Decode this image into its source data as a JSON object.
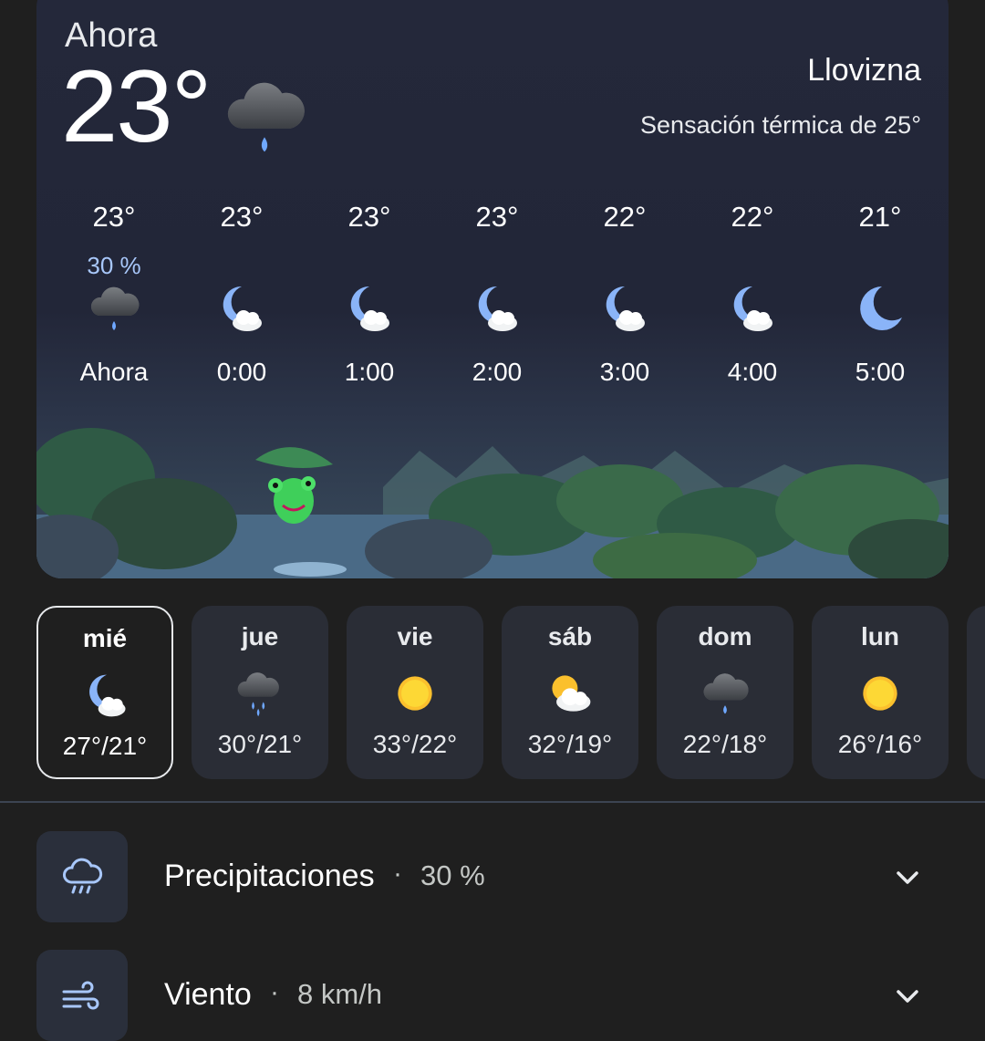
{
  "current": {
    "label": "Ahora",
    "temp": "23°",
    "icon": "drizzle-cloud-icon",
    "condition": "Llovizna",
    "feels_like": "Sensación térmica de 25°"
  },
  "hourly": [
    {
      "temp": "23°",
      "precip": "30 %",
      "icon": "drizzle-cloud-icon",
      "time": "Ahora"
    },
    {
      "temp": "23°",
      "precip": "",
      "icon": "moon-cloud-icon",
      "time": "0:00"
    },
    {
      "temp": "23°",
      "precip": "",
      "icon": "moon-cloud-icon",
      "time": "1:00"
    },
    {
      "temp": "23°",
      "precip": "",
      "icon": "moon-cloud-icon",
      "time": "2:00"
    },
    {
      "temp": "22°",
      "precip": "",
      "icon": "moon-cloud-icon",
      "time": "3:00"
    },
    {
      "temp": "22°",
      "precip": "",
      "icon": "moon-cloud-icon",
      "time": "4:00"
    },
    {
      "temp": "21°",
      "precip": "",
      "icon": "moon-icon",
      "time": "5:00"
    }
  ],
  "daily": [
    {
      "day": "mié",
      "icon": "moon-cloud-icon",
      "range": "27°/21°",
      "selected": true
    },
    {
      "day": "jue",
      "icon": "rain-cloud-icon",
      "range": "30°/21°"
    },
    {
      "day": "vie",
      "icon": "sun-icon",
      "range": "33°/22°"
    },
    {
      "day": "sáb",
      "icon": "sun-cloud-icon",
      "range": "32°/19°"
    },
    {
      "day": "dom",
      "icon": "drizzle-cloud-icon",
      "range": "22°/18°"
    },
    {
      "day": "lun",
      "icon": "sun-icon",
      "range": "26°/16°"
    }
  ],
  "details": [
    {
      "label": "Precipitaciones",
      "separator": "·",
      "value": "30 %",
      "icon": "rain-outline-icon"
    },
    {
      "label": "Viento",
      "separator": "·",
      "value": "8 km/h",
      "icon": "wind-icon"
    }
  ],
  "colors": {
    "background": "#1f1f1f",
    "card": "#24283a",
    "accent_blue": "#a8c7fa",
    "sun": "#fbc02d"
  }
}
